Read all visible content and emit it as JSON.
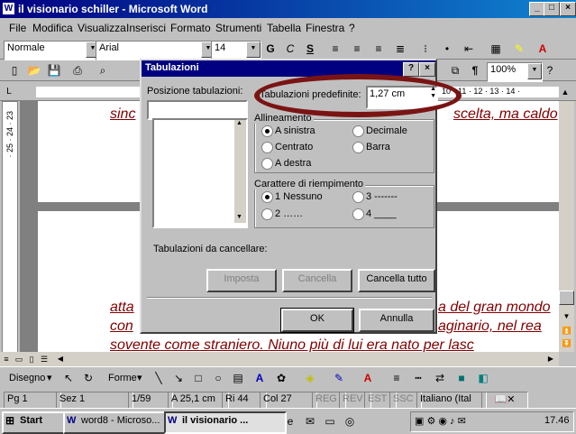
{
  "window": {
    "title": "il visionario schiller - Microsoft Word"
  },
  "menu": [
    "File",
    "Modifica",
    "Visualizza",
    "Inserisci",
    "Formato",
    "Strumenti",
    "Tabella",
    "Finestra",
    "?"
  ],
  "format_toolbar": {
    "style": "Normale",
    "font": "Arial",
    "size": "14"
  },
  "standard_toolbar": {
    "zoom": "100%"
  },
  "document": {
    "line1": "sinc",
    "line1_right": "scelta, ma caldo",
    "line2_left": "atta",
    "line2_right": "a del gran mondo",
    "line3_left": "con",
    "line3_right": "aginario, nel rea",
    "line4": "sovente come straniero. Niuno più di lui era nato per lasc"
  },
  "dialog": {
    "title": "Tabulazioni",
    "positions_label": "Posizione tabulazioni:",
    "default_label": "Tabulazioni predefinite:",
    "default_value": "1,27 cm",
    "alignment_label": "Allineamento",
    "align_left": "A sinistra",
    "align_center": "Centrato",
    "align_right": "A destra",
    "align_decimal": "Decimale",
    "align_bar": "Barra",
    "leader_label": "Carattere di riempimento",
    "leader_1": "1 Nessuno",
    "leader_2": "2 ……",
    "leader_3": "3 -------",
    "leader_4": "4 ____",
    "clear_label": "Tabulazioni da cancellare:",
    "set_button": "Imposta",
    "clear_button": "Cancella",
    "clear_all_button": "Cancella tutto",
    "ok_button": "OK",
    "cancel_button": "Annulla"
  },
  "drawing_toolbar": {
    "draw": "Disegno",
    "shapes": "Forme"
  },
  "status": {
    "page": "Pg 1",
    "section": "Sez 1",
    "pages": "1/59",
    "at": "A 25,1 cm",
    "line": "Ri 44",
    "col": "Col 27",
    "rec": "REG",
    "rev": "REV",
    "ext": "EST",
    "ovr": "SSC",
    "lang": "Italiano (Ital"
  },
  "taskbar": {
    "start": "Start",
    "task1": "word8 - Microso...",
    "task2": "il visionario ...",
    "clock": "17.46"
  },
  "colors": {
    "title": "#000080",
    "doc_text": "#800000",
    "highlight": "#7a1414"
  }
}
